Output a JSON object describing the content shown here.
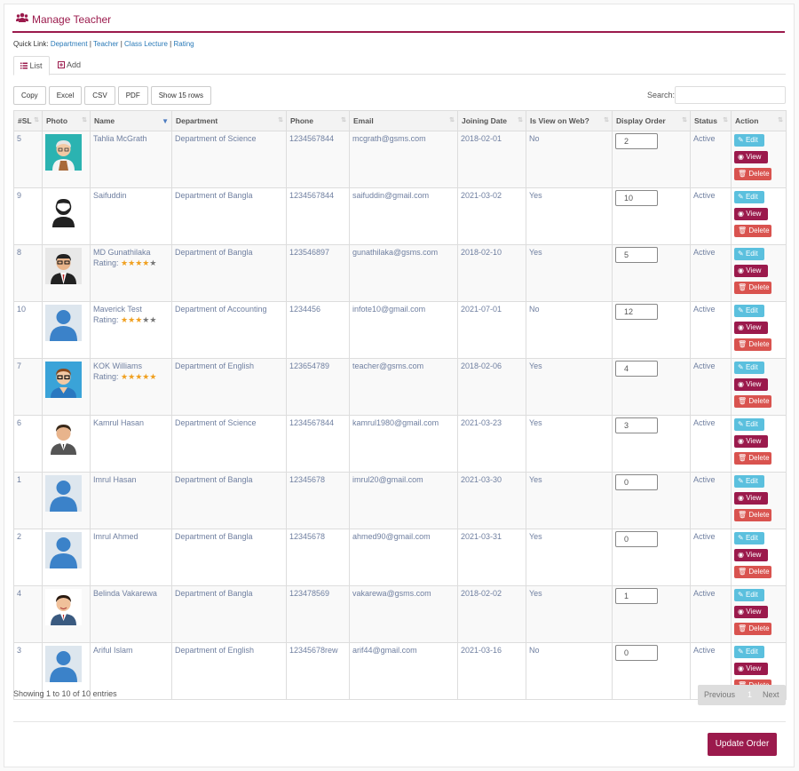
{
  "header": {
    "title": "Manage Teacher"
  },
  "quick_link": {
    "label": "Quick Link:",
    "links": [
      "Department",
      "Teacher",
      "Class Lecture",
      "Rating"
    ]
  },
  "tabs": [
    {
      "label": "List",
      "active": true
    },
    {
      "label": "Add",
      "active": false
    }
  ],
  "buttons": [
    "Copy",
    "Excel",
    "CSV",
    "PDF",
    "Show 15 rows"
  ],
  "search": {
    "label": "Search:",
    "value": ""
  },
  "table": {
    "columns": [
      "#SL",
      "Photo",
      "Name",
      "Department",
      "Phone",
      "Email",
      "Joining Date",
      "Is View on Web?",
      "Display Order",
      "Status",
      "Action"
    ],
    "rows": [
      {
        "sl": "5",
        "avatar": "old-man",
        "name": "Tahlia McGrath",
        "rating": null,
        "department": "Department of Science",
        "phone": "1234567844",
        "email": "mcgrath@gsms.com",
        "joining": "2018-02-01",
        "web": "No",
        "order": "2",
        "status": "Active"
      },
      {
        "sl": "9",
        "avatar": "bearded-man",
        "name": "Saifuddin",
        "rating": null,
        "department": "Department of Bangla",
        "phone": "1234567844",
        "email": "saifuddin@gmail.com",
        "joining": "2021-03-02",
        "web": "Yes",
        "order": "10",
        "status": "Active"
      },
      {
        "sl": "8",
        "avatar": "man-glasses-suit",
        "name": "MD Gunathilaka",
        "rating": 4,
        "department": "Department of Bangla",
        "phone": "123546897",
        "email": "gunathilaka@gsms.com",
        "joining": "2018-02-10",
        "web": "Yes",
        "order": "5",
        "status": "Active"
      },
      {
        "sl": "10",
        "avatar": "placeholder",
        "name": "Maverick Test",
        "rating": 3,
        "department": "Department of Accounting",
        "phone": "1234456",
        "email": "infote10@gmail.com",
        "joining": "2021-07-01",
        "web": "No",
        "order": "12",
        "status": "Active"
      },
      {
        "sl": "7",
        "avatar": "man-glasses-casual",
        "name": "KOK Williams",
        "rating": 5,
        "department": "Department of English",
        "phone": "123654789",
        "email": "teacher@gsms.com",
        "joining": "2018-02-06",
        "web": "Yes",
        "order": "4",
        "status": "Active"
      },
      {
        "sl": "6",
        "avatar": "man-suit",
        "name": "Kamrul Hasan",
        "rating": null,
        "department": "Department of Science",
        "phone": "1234567844",
        "email": "kamrul1980@gmail.com",
        "joining": "2021-03-23",
        "web": "Yes",
        "order": "3",
        "status": "Active"
      },
      {
        "sl": "1",
        "avatar": "placeholder",
        "name": "Imrul Hasan",
        "rating": null,
        "department": "Department of Bangla",
        "phone": "12345678",
        "email": "imrul20@gmail.com",
        "joining": "2021-03-30",
        "web": "Yes",
        "order": "0",
        "status": "Active"
      },
      {
        "sl": "2",
        "avatar": "placeholder",
        "name": "Imrul Ahmed",
        "rating": null,
        "department": "Department of Bangla",
        "phone": "12345678",
        "email": "ahmed90@gmail.com",
        "joining": "2021-03-31",
        "web": "Yes",
        "order": "0",
        "status": "Active"
      },
      {
        "sl": "4",
        "avatar": "man-suit-smile",
        "name": "Belinda Vakarewa",
        "rating": null,
        "department": "Department of Bangla",
        "phone": "123478569",
        "email": "vakarewa@gsms.com",
        "joining": "2018-02-02",
        "web": "Yes",
        "order": "1",
        "status": "Active"
      },
      {
        "sl": "3",
        "avatar": "placeholder",
        "name": "Ariful Islam",
        "rating": null,
        "department": "Department of English",
        "phone": "12345678rew",
        "email": "arif44@gmail.com",
        "joining": "2021-03-16",
        "web": "No",
        "order": "0",
        "status": "Active"
      }
    ]
  },
  "rating_label": "Rating:",
  "actions": {
    "edit": "Edit",
    "view": "View",
    "delete": "Delete"
  },
  "footer": {
    "info": "Showing 1 to 10 of 10 entries",
    "previous": "Previous",
    "page": "1",
    "next": "Next",
    "update_button": "Update Order"
  },
  "colors": {
    "brand": "#9b1a4c",
    "edit": "#5bc0de",
    "delete": "#d9534f",
    "link": "#2a7ab8",
    "star": "#f0a020"
  }
}
